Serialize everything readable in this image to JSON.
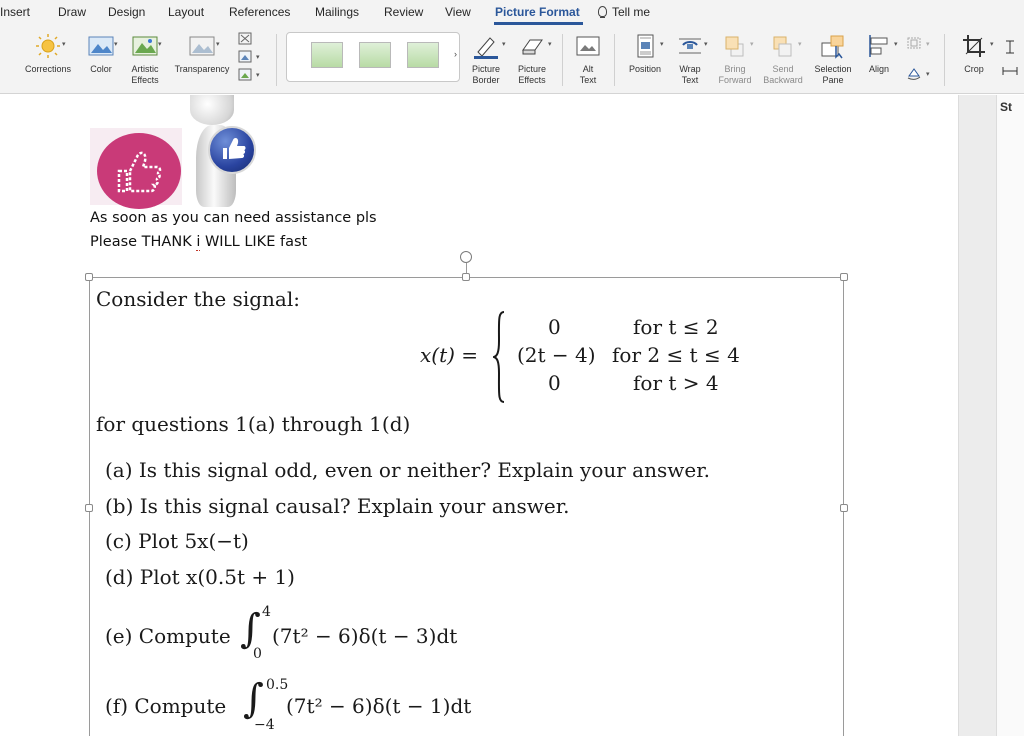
{
  "tabs": [
    "Insert",
    "Draw",
    "Design",
    "Layout",
    "References",
    "Mailings",
    "Review",
    "View",
    "Picture Format",
    "Tell me"
  ],
  "ribbon": {
    "corrections": "Corrections",
    "color": "Color",
    "artistic_effects": [
      "Artistic",
      "Effects"
    ],
    "transparency": "Transparency",
    "picture_border": [
      "Picture",
      "Border"
    ],
    "picture_effects": [
      "Picture",
      "Effects"
    ],
    "alt_text": [
      "Alt",
      "Text"
    ],
    "position": "Position",
    "wrap_text": [
      "Wrap",
      "Text"
    ],
    "bring_forward": [
      "Bring",
      "Forward"
    ],
    "send_backward": [
      "Send",
      "Backward"
    ],
    "selection_pane": [
      "Selection",
      "Pane"
    ],
    "align": "Align",
    "crop": "Crop",
    "side_tab": "St",
    "accent_color": "#2b579a"
  },
  "document": {
    "note_line1": "As soon as you can need assistance pls",
    "note_line2_a": "Please THANK ",
    "note_line2_i": "i",
    "note_line2_b": " WILL LIKE fast"
  },
  "problem": {
    "intro": "Consider the signal:",
    "lhs": "x(t) =",
    "cases": [
      {
        "value": "0",
        "condition": "for t ≤ 2"
      },
      {
        "value": "(2t − 4)",
        "condition": "for 2 ≤ t ≤ 4"
      },
      {
        "value": "0",
        "condition": "for t > 4"
      }
    ],
    "after": "for questions 1(a) through 1(d)",
    "questions": [
      "(a)  Is this signal odd, even or neither? Explain your answer.",
      "(b)  Is this signal causal? Explain your answer.",
      "(c)  Plot 5x(−t)",
      "(d)  Plot x(0.5t + 1)"
    ],
    "e_label": "(e)  Compute",
    "e_integrand": "(7t² − 6)δ(t − 3)dt",
    "e_upper": "4",
    "e_lower": "0",
    "f_label": "(f)  Compute",
    "f_integrand": "(7t² − 6)δ(t − 1)dt",
    "f_upper": "0.5",
    "f_lower": "−4"
  }
}
